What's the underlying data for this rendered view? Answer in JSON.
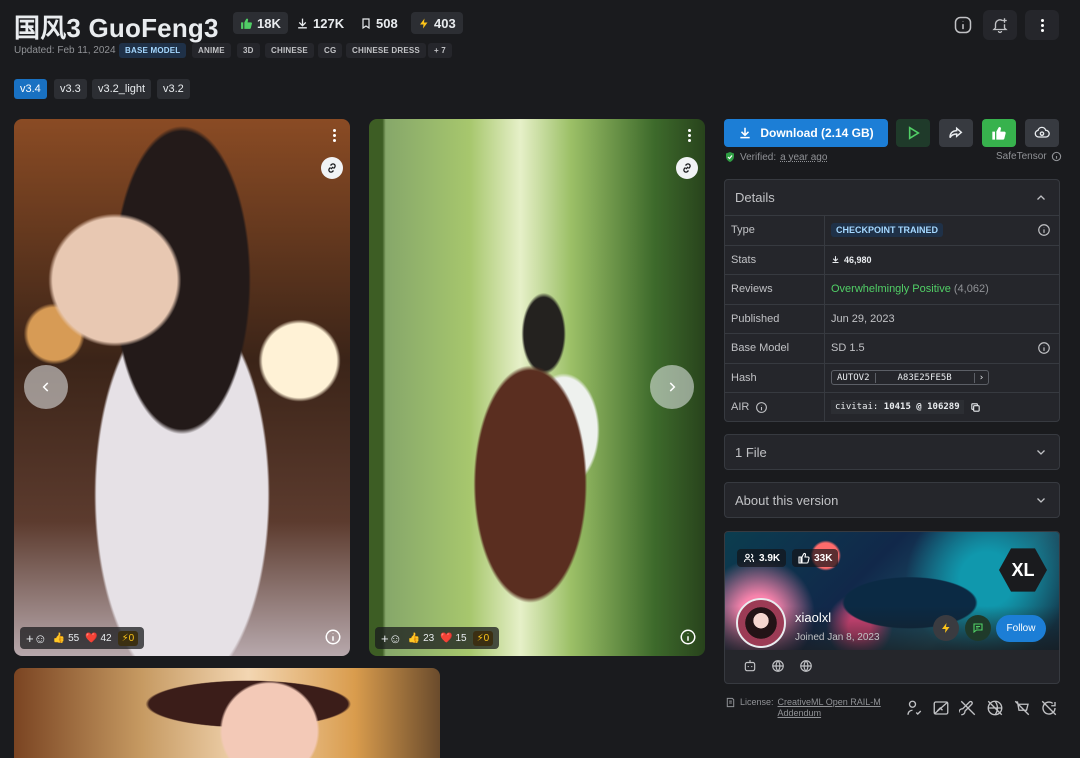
{
  "header": {
    "title": "国风3 GuoFeng3",
    "stats": {
      "likes": "18K",
      "downloads": "127K",
      "bookmarks": "508",
      "buzz": "403"
    },
    "updated": "Updated: Feb 11, 2024",
    "tags": [
      "BASE MODEL",
      "ANIME",
      "3D",
      "CHINESE",
      "CG",
      "CHINESE DRESS",
      "+ 7"
    ],
    "colors": {
      "like": "#51cf66",
      "buzz": "#fcc419",
      "accent": "#1c7ed6"
    }
  },
  "versions": [
    "v3.4",
    "v3.3",
    "v3.2_light",
    "v3.2"
  ],
  "gallery": {
    "images": [
      {
        "reactions": {
          "likes": "55",
          "hearts": "42",
          "buzz": "0"
        }
      },
      {
        "reactions": {
          "likes": "23",
          "hearts": "15",
          "buzz": "0"
        }
      }
    ]
  },
  "sidebar": {
    "download_label": "Download (2.14 GB)",
    "verified_prefix": "Verified:",
    "verified_time": "a year ago",
    "safetensor": "SafeTensor",
    "details": {
      "title": "Details",
      "type_label": "Type",
      "type_value": "CHECKPOINT TRAINED",
      "stats_label": "Stats",
      "stats_value": "46,980",
      "reviews_label": "Reviews",
      "reviews_value": "Overwhelmingly Positive",
      "reviews_count": "(4,062)",
      "published_label": "Published",
      "published_value": "Jun 29, 2023",
      "basemodel_label": "Base Model",
      "basemodel_value": "SD 1.5",
      "hash_label": "Hash",
      "hash_type": "AUTOV2",
      "hash_value": "A83E25FE5B",
      "air_label": "AIR",
      "air_prefix": "civitai:",
      "air_value": "10415 @ 106289"
    },
    "files_label": "1 File",
    "about_label": "About this version",
    "creator": {
      "followers": "3.9K",
      "likes": "33K",
      "badge": "XL",
      "name": "xiaolxl",
      "joined": "Joined Jan 8, 2023",
      "follow_label": "Follow"
    },
    "license": {
      "prefix": "License:",
      "name": "CreativeML Open RAIL-M",
      "addendum": "Addendum"
    }
  }
}
